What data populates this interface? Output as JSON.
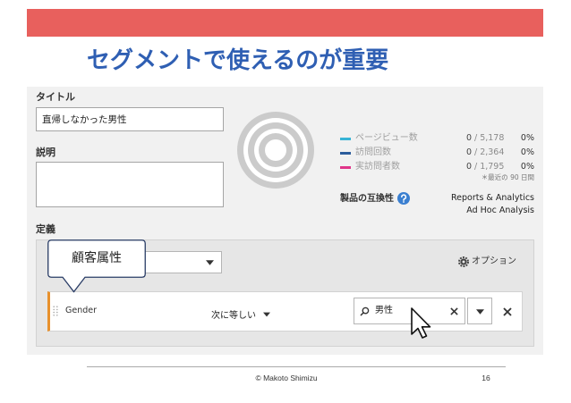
{
  "slide": {
    "title": "セグメントで使えるのが重要",
    "copyright": "© Makoto Shimizu",
    "page_number": "16",
    "banner_color": "#e8605d",
    "title_color": "#2f5fb3"
  },
  "form": {
    "title_label": "タイトル",
    "title_value": "直帰しなかった男性",
    "description_label": "説明",
    "definition_label": "定義"
  },
  "stats": {
    "separator": "/",
    "items": [
      {
        "label": "ページビュー数",
        "value": "0",
        "total": "5,178",
        "percent": "0%",
        "color": "#38b4d6"
      },
      {
        "label": "訪問回数",
        "value": "0",
        "total": "2,364",
        "percent": "0%",
        "color": "#2c5d9c"
      },
      {
        "label": "実訪問者数",
        "value": "0",
        "total": "1,795",
        "percent": "0%",
        "color": "#e03589"
      }
    ],
    "period_note": "＊最近の 90 日間",
    "compat_label": "製品の互換性",
    "compat_values": [
      "Reports & Analytics",
      "Ad Hoc Analysis"
    ],
    "help_color": "#3a7fd0"
  },
  "definition": {
    "callout_text": "顧客属性",
    "options_label": "オプション",
    "rule": {
      "dimension": "Gender",
      "operator": "次に等しい",
      "value": "男性"
    },
    "rule_accent_color": "#e8912d"
  },
  "icons": {
    "options": "gear-icon",
    "compat_help": "help-icon",
    "search": "search-icon",
    "clear": "close-icon",
    "dropdown": "chevron-down-icon",
    "drag": "drag-handle-icon",
    "pointer": "mouse-cursor-icon"
  }
}
